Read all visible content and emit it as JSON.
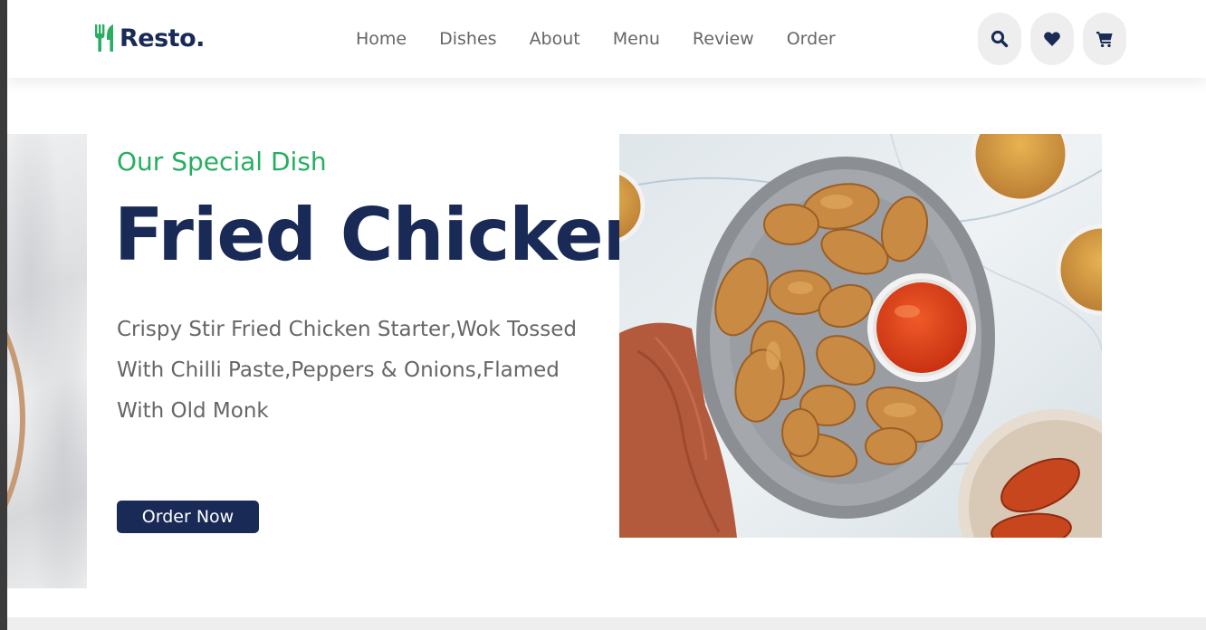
{
  "header": {
    "logo_text": "Resto.",
    "nav": [
      "Home",
      "Dishes",
      "About",
      "Menu",
      "Review",
      "Order"
    ],
    "icons": [
      "search-icon",
      "heart-icon",
      "cart-icon"
    ]
  },
  "hero": {
    "subtitle": "Our Special Dish",
    "title": "Fried Chicken",
    "description": "Crispy Stir Fried Chicken Starter,Wok Tossed With Chilli Paste,Peppers & Onions,Flamed With Old Monk",
    "button_label": "Order Now"
  },
  "colors": {
    "accent": "#27ae60",
    "primary": "#192a56",
    "text": "#666666",
    "icon_bg": "#eeeeee"
  }
}
